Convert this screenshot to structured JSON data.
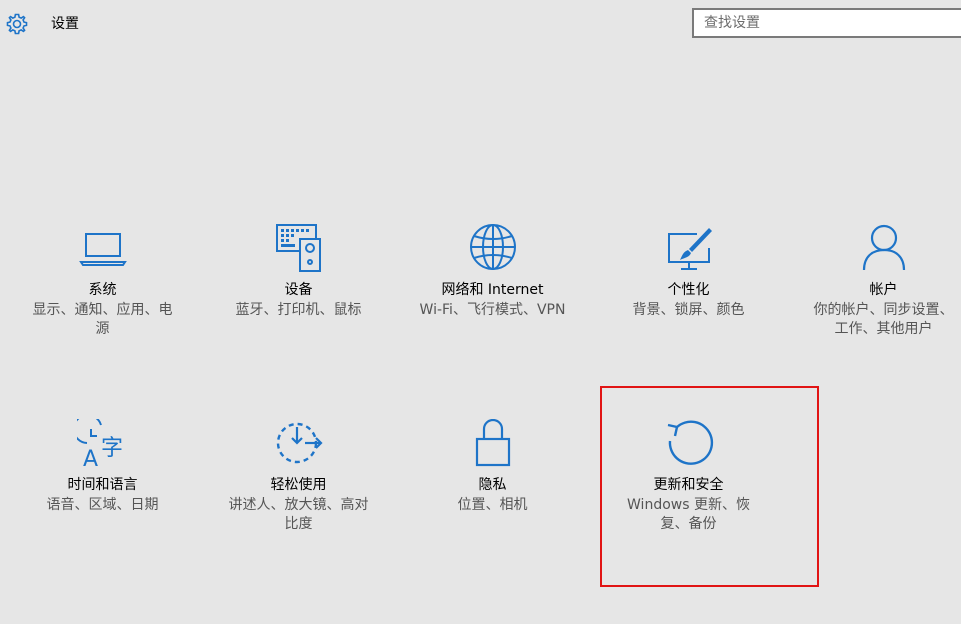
{
  "header": {
    "title": "设置",
    "icon": "gear-icon"
  },
  "search": {
    "placeholder": "查找设置",
    "value": ""
  },
  "colors": {
    "accent": "#1e74c8",
    "highlight_border": "#e11414",
    "background": "#e6e6e6"
  },
  "tiles": [
    {
      "title": "系统",
      "desc": "显示、通知、应用、电源",
      "icon": "laptop-icon"
    },
    {
      "title": "设备",
      "desc": "蓝牙、打印机、鼠标",
      "icon": "keyboard-speaker-icon"
    },
    {
      "title": "网络和 Internet",
      "desc": "Wi-Fi、飞行模式、VPN",
      "icon": "globe-icon"
    },
    {
      "title": "个性化",
      "desc": "背景、锁屏、颜色",
      "icon": "paint-brush-icon"
    },
    {
      "title": "帐户",
      "desc": "你的帐户、同步设置、工作、其他用户",
      "icon": "person-icon"
    },
    {
      "title": "时间和语言",
      "desc": "语音、区域、日期",
      "icon": "clock-language-icon"
    },
    {
      "title": "轻松使用",
      "desc": "讲述人、放大镜、高对比度",
      "icon": "ease-of-access-icon"
    },
    {
      "title": "隐私",
      "desc": "位置、相机",
      "icon": "lock-icon"
    },
    {
      "title": "更新和安全",
      "desc": "Windows 更新、恢复、备份",
      "icon": "refresh-icon"
    }
  ]
}
